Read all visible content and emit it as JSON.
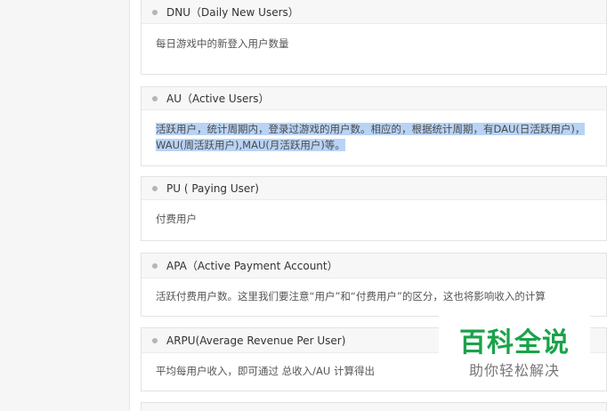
{
  "cards": [
    {
      "title": "DNU（Daily New Users）",
      "body": "每日游戏中的新登入用户数量"
    },
    {
      "title": "AU（Active Users）",
      "body": "活跃用户，统计周期内，登录过游戏的用户数。相应的，根据统计周期，有DAU(日活跃用户)，WAU(周活跃用户),MAU(月活跃用户)等。",
      "selected": true
    },
    {
      "title": "PU ( Paying User)",
      "body": "付费用户"
    },
    {
      "title": "APA（Active Payment Account）",
      "body": "活跃付费用户数。这里我们要注意“用户”和“付费用户”的区分，这也将影响收入的计算"
    },
    {
      "title": "ARPU(Average Revenue Per User)",
      "body": "平均每用户收入，即可通过 总收入/AU 计算得出"
    }
  ],
  "watermark": {
    "main": "百科全说",
    "sub": "助你轻松解决"
  }
}
